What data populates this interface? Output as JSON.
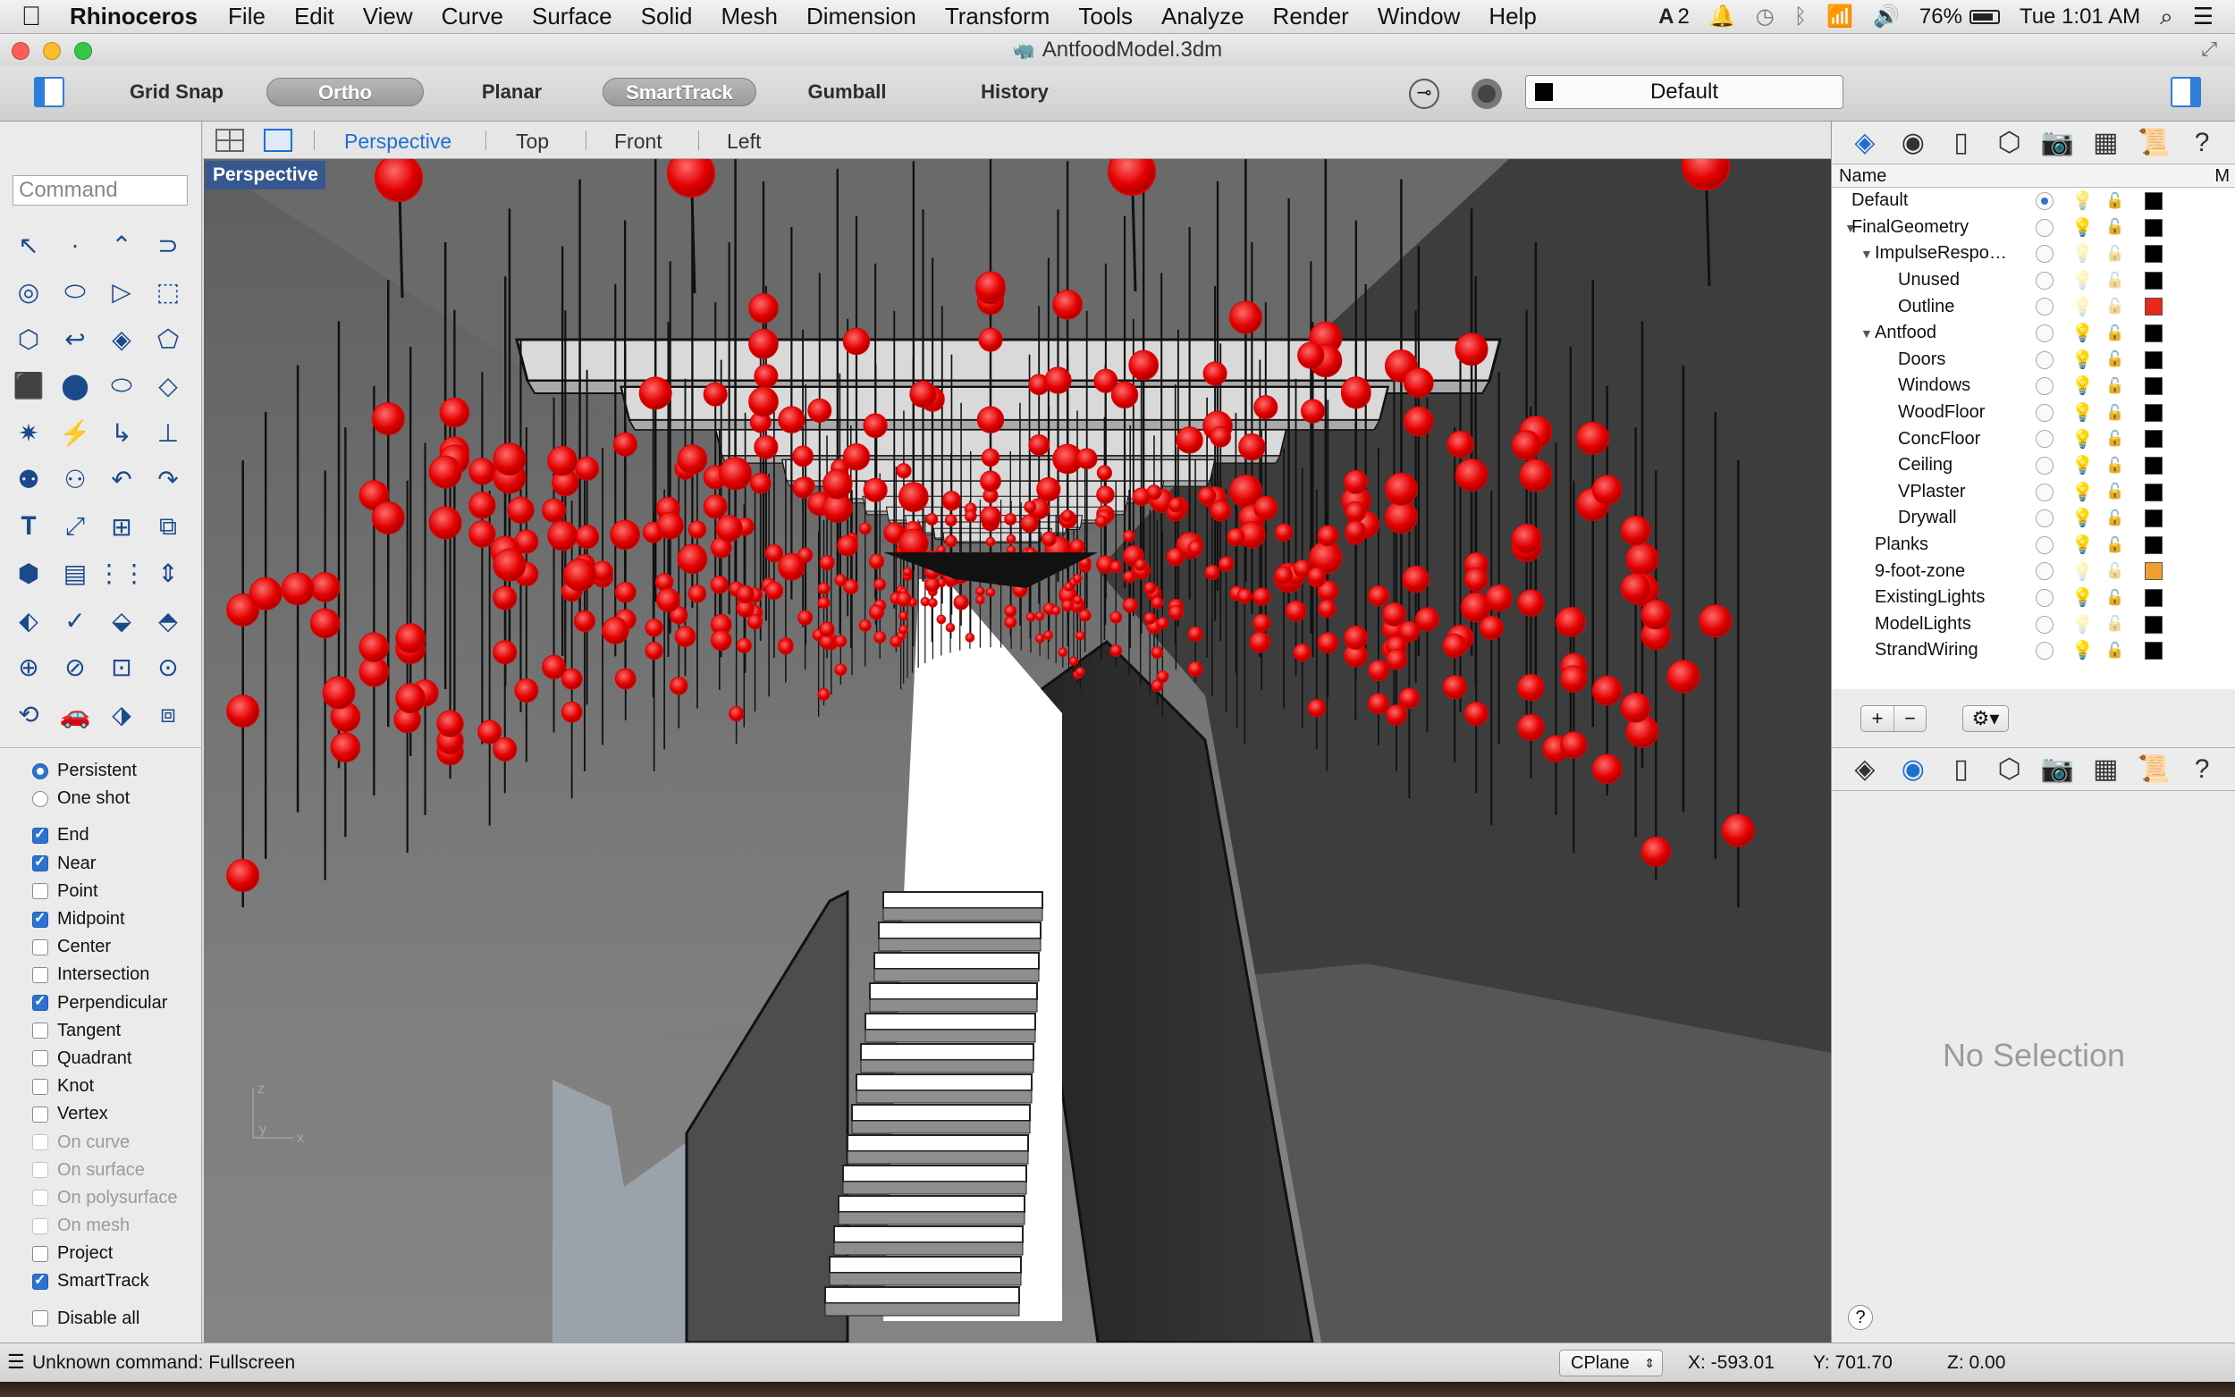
{
  "menubar": {
    "app_name": "Rhinoceros",
    "menus": [
      "File",
      "Edit",
      "View",
      "Curve",
      "Surface",
      "Solid",
      "Mesh",
      "Dimension",
      "Transform",
      "Tools",
      "Analyze",
      "Render",
      "Window",
      "Help"
    ],
    "adobe_count": "2",
    "battery": "76%",
    "clock": "Tue 1:01 AM"
  },
  "window": {
    "title": "AntfoodModel.3dm"
  },
  "toolbar": {
    "grid_snap": "Grid Snap",
    "ortho": "Ortho",
    "planar": "Planar",
    "smarttrack": "SmartTrack",
    "gumball": "Gumball",
    "history": "History",
    "current_layer": "Default"
  },
  "command": {
    "placeholder": "Command"
  },
  "tools": [
    "↖",
    "·",
    "⌃",
    "⊃",
    "◎",
    "⬭",
    "▷",
    "⬚",
    "⬡",
    "↩",
    "◈",
    "⬠",
    "⬛",
    "⬤",
    "⬭",
    "◇",
    "✷",
    "⚡",
    "↳",
    "⊥",
    "⚉",
    "⚇",
    "↶",
    "↷",
    "𝐓",
    "⤢",
    "⊞",
    "⧉",
    "⬢",
    "▤",
    "⋮⋮",
    "⇕",
    "⬖",
    "✓",
    "⬙",
    "⬘",
    "⊕",
    "⊘",
    "⊡",
    "⊙",
    "⟲",
    "🚗",
    "⬗",
    "⧈"
  ],
  "osnap": {
    "modes": [
      {
        "label": "Persistent",
        "type": "radio",
        "checked": true,
        "enabled": true
      },
      {
        "label": "One shot",
        "type": "radio",
        "checked": false,
        "enabled": true
      }
    ],
    "items": [
      {
        "label": "End",
        "checked": true,
        "enabled": true
      },
      {
        "label": "Near",
        "checked": true,
        "enabled": true
      },
      {
        "label": "Point",
        "checked": false,
        "enabled": true
      },
      {
        "label": "Midpoint",
        "checked": true,
        "enabled": true
      },
      {
        "label": "Center",
        "checked": false,
        "enabled": true
      },
      {
        "label": "Intersection",
        "checked": false,
        "enabled": true
      },
      {
        "label": "Perpendicular",
        "checked": true,
        "enabled": true
      },
      {
        "label": "Tangent",
        "checked": false,
        "enabled": true
      },
      {
        "label": "Quadrant",
        "checked": false,
        "enabled": true
      },
      {
        "label": "Knot",
        "checked": false,
        "enabled": true
      },
      {
        "label": "Vertex",
        "checked": false,
        "enabled": true
      },
      {
        "label": "On curve",
        "checked": false,
        "enabled": false
      },
      {
        "label": "On surface",
        "checked": false,
        "enabled": false
      },
      {
        "label": "On polysurface",
        "checked": false,
        "enabled": false
      },
      {
        "label": "On mesh",
        "checked": false,
        "enabled": false
      },
      {
        "label": "Project",
        "checked": false,
        "enabled": true
      },
      {
        "label": "SmartTrack",
        "checked": true,
        "enabled": true
      },
      {
        "label": "Disable all",
        "checked": false,
        "enabled": true
      }
    ]
  },
  "viewport_tabs": [
    "Perspective",
    "Top",
    "Front",
    "Left"
  ],
  "viewport": {
    "label": "Perspective",
    "axis_z": "z",
    "axis_y": "y",
    "axis_x": "x",
    "bulb_color": "#e30000"
  },
  "layers": {
    "header_name": "Name",
    "header_m": "M",
    "rows": [
      {
        "name": "Default",
        "depth": 0,
        "expander": "",
        "current": true,
        "light": "dim",
        "color": "#000000"
      },
      {
        "name": "FinalGeometry",
        "depth": 0,
        "expander": "▼",
        "current": false,
        "light": "on",
        "color": "#000000"
      },
      {
        "name": "ImpulseRespo…",
        "depth": 1,
        "expander": "▼",
        "current": false,
        "light": "off",
        "color": "#000000"
      },
      {
        "name": "Unused",
        "depth": 2,
        "expander": "",
        "current": false,
        "light": "off",
        "color": "#000000"
      },
      {
        "name": "Outline",
        "depth": 2,
        "expander": "",
        "current": false,
        "light": "off",
        "color": "#e8281c"
      },
      {
        "name": "Antfood",
        "depth": 1,
        "expander": "▼",
        "current": false,
        "light": "on",
        "color": "#000000"
      },
      {
        "name": "Doors",
        "depth": 2,
        "expander": "",
        "current": false,
        "light": "on",
        "color": "#000000"
      },
      {
        "name": "Windows",
        "depth": 2,
        "expander": "",
        "current": false,
        "light": "on",
        "color": "#000000"
      },
      {
        "name": "WoodFloor",
        "depth": 2,
        "expander": "",
        "current": false,
        "light": "on",
        "color": "#000000"
      },
      {
        "name": "ConcFloor",
        "depth": 2,
        "expander": "",
        "current": false,
        "light": "on",
        "color": "#000000"
      },
      {
        "name": "Ceiling",
        "depth": 2,
        "expander": "",
        "current": false,
        "light": "on",
        "color": "#000000"
      },
      {
        "name": "VPlaster",
        "depth": 2,
        "expander": "",
        "current": false,
        "light": "on",
        "color": "#000000"
      },
      {
        "name": "Drywall",
        "depth": 2,
        "expander": "",
        "current": false,
        "light": "on",
        "color": "#000000"
      },
      {
        "name": "Planks",
        "depth": 1,
        "expander": "",
        "current": false,
        "light": "on",
        "color": "#000000"
      },
      {
        "name": "9-foot-zone",
        "depth": 1,
        "expander": "",
        "current": false,
        "light": "off",
        "color": "#f0a030"
      },
      {
        "name": "ExistingLights",
        "depth": 1,
        "expander": "",
        "current": false,
        "light": "on",
        "color": "#000000"
      },
      {
        "name": "ModelLights",
        "depth": 1,
        "expander": "",
        "current": false,
        "light": "off",
        "color": "#000000"
      },
      {
        "name": "StrandWiring",
        "depth": 1,
        "expander": "",
        "current": false,
        "light": "on",
        "color": "#000000"
      }
    ]
  },
  "properties": {
    "empty_text": "No Selection",
    "help": "?"
  },
  "status": {
    "message": "Unknown command: Fullscreen",
    "cplane": "CPlane",
    "x": "X: -593.01",
    "y": "Y: 701.70",
    "z": "Z: 0.00"
  }
}
